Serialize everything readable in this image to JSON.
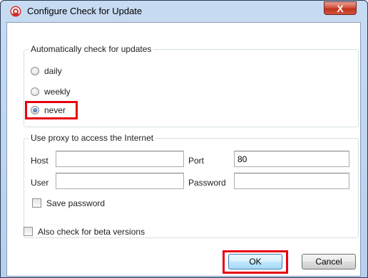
{
  "window": {
    "title": "Configure Check for Update",
    "close_label": "X",
    "app_icon": "app-logo-icon"
  },
  "auto_update": {
    "group_title": "Automatically check for updates",
    "options": [
      {
        "label": "daily",
        "checked": false
      },
      {
        "label": "weekly",
        "checked": false
      },
      {
        "label": "never",
        "checked": true
      }
    ]
  },
  "proxy": {
    "group_title": "Use proxy to access the Internet",
    "host_label": "Host",
    "host_value": "",
    "port_label": "Port",
    "port_value": "80",
    "user_label": "User",
    "user_value": "",
    "password_label": "Password",
    "password_value": "",
    "save_password_label": "Save password",
    "save_password_checked": false
  },
  "beta": {
    "label": "Also check for beta versions",
    "checked": false
  },
  "buttons": {
    "ok": "OK",
    "cancel": "Cancel"
  },
  "colors": {
    "highlight": "#e8000f",
    "close_button": "#c1311a",
    "title_bar": "#c7dbf2"
  }
}
